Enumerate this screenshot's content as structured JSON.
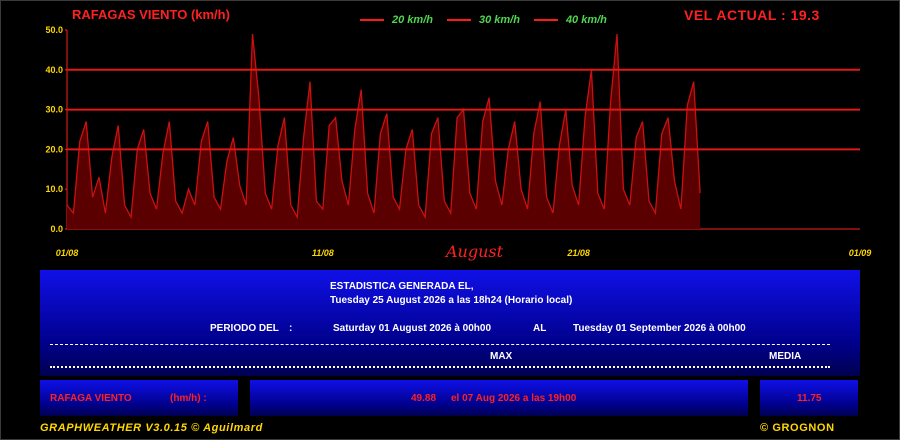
{
  "header": {
    "chart_title": "RAFAGAS VIENTO (km/h)",
    "current_label": "VEL ACTUAL : 19.3"
  },
  "legend": [
    {
      "label": "20 km/h"
    },
    {
      "label": "30 km/h"
    },
    {
      "label": "40 km/h"
    }
  ],
  "month_label": "August",
  "colors": {
    "background": "#000000",
    "series": "#cc1010",
    "threshold": "#e01818",
    "legend_text": "#4fd64f",
    "footer": "#ffd700",
    "panel": "#0000c8"
  },
  "chart_data": {
    "type": "area",
    "title": "RAFAGAS VIENTO (km/h)",
    "ylim": [
      0,
      50
    ],
    "yticks": [
      "0.0",
      "10.0",
      "20.0",
      "30.0",
      "40.0",
      "50.0"
    ],
    "xlim_days": [
      1,
      32
    ],
    "xticks": [
      {
        "label": "01/08",
        "day": 1
      },
      {
        "label": "11/08",
        "day": 11
      },
      {
        "label": "21/08",
        "day": 21
      },
      {
        "label": "01/09",
        "day": 32
      }
    ],
    "thresholds": [
      20,
      30,
      40
    ],
    "series": [
      {
        "x_day": [
          1,
          1.25,
          1.5,
          1.75,
          2,
          2.25,
          2.5,
          2.75,
          3,
          3.25,
          3.5,
          3.75,
          4,
          4.25,
          4.5,
          4.75,
          5,
          5.25,
          5.5,
          5.75,
          6,
          6.25,
          6.5,
          6.75,
          7,
          7.25,
          7.5,
          7.75,
          8,
          8.25,
          8.5,
          8.75,
          9,
          9.25,
          9.5,
          9.75,
          10,
          10.25,
          10.5,
          10.75,
          11,
          11.25,
          11.5,
          11.75,
          12,
          12.25,
          12.5,
          12.75,
          13,
          13.25,
          13.5,
          13.75,
          14,
          14.25,
          14.5,
          14.75,
          15,
          15.25,
          15.5,
          15.75,
          16,
          16.25,
          16.5,
          16.75,
          17,
          17.25,
          17.5,
          17.75,
          18,
          18.25,
          18.5,
          18.75,
          19,
          19.25,
          19.5,
          19.75,
          20,
          20.25,
          20.5,
          20.75,
          21,
          21.25,
          21.5,
          21.75,
          22,
          22.25,
          22.5,
          22.75,
          23,
          23.25,
          23.5,
          23.75,
          24,
          24.25,
          24.5,
          24.75,
          25,
          25.25,
          25.5,
          25.75
        ],
        "values": [
          6,
          4,
          22,
          27,
          8,
          13,
          4,
          18,
          26,
          6,
          3,
          20,
          25,
          9,
          5,
          19,
          27,
          7,
          4,
          10,
          6,
          22,
          27,
          8,
          5,
          17,
          23,
          11,
          6,
          49,
          33,
          9,
          5,
          21,
          28,
          6,
          3,
          23,
          37,
          7,
          5,
          26,
          28,
          12,
          6,
          25,
          35,
          9,
          4,
          24,
          29,
          8,
          5,
          20,
          25,
          6,
          3,
          24,
          28,
          7,
          4,
          28,
          30,
          9,
          5,
          27,
          33,
          12,
          6,
          20,
          27,
          10,
          5,
          24,
          32,
          8,
          4,
          21,
          30,
          11,
          6,
          28,
          40,
          9,
          5,
          32,
          49,
          10,
          6,
          23,
          27,
          7,
          4,
          24,
          28,
          12,
          5,
          31,
          37,
          9,
          6,
          25,
          32,
          23
        ]
      }
    ]
  },
  "stats": {
    "generated_title": "ESTADISTICA GENERADA EL,",
    "generated_date": "Tuesday 25 August 2026 a las 18h24  (Horario local)",
    "period_label": "PERIODO DEL",
    "period_colon": ":",
    "period_start": "Saturday 01 August 2026 à 00h00",
    "period_al": "AL",
    "period_end": "Tuesday 01 September 2026 à 00h00",
    "col_max": "MAX",
    "col_media": "MEDIA"
  },
  "row": {
    "label": "RAFAGA VIENTO",
    "unit": "(hm/h) :",
    "max_value": "49.88",
    "max_when": "el 07 Aug 2026 a las 19h00",
    "media_value": "11.75"
  },
  "footer": {
    "left": "GRAPHWEATHER V3.0.15 © Aguilmard",
    "right": "© GROGNON"
  }
}
